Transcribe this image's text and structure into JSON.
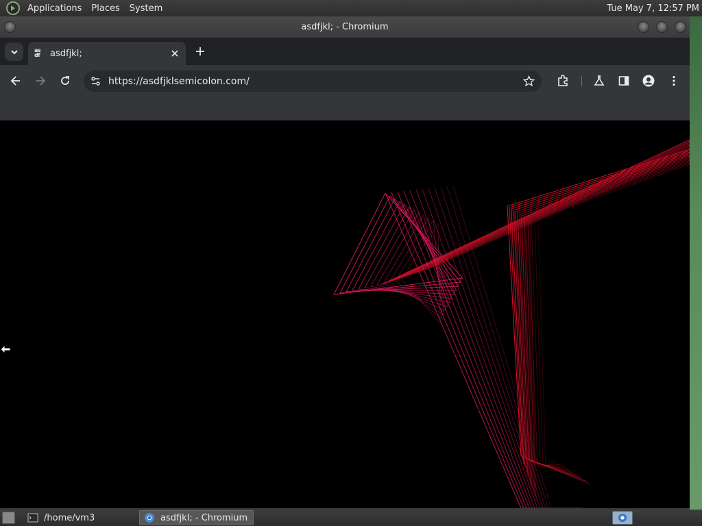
{
  "top_panel": {
    "menus": [
      "Applications",
      "Places",
      "System"
    ],
    "clock": "Tue May  7, 12:57 PM"
  },
  "window": {
    "title": "asdfjkl; - Chromium"
  },
  "browser": {
    "tab": {
      "favicon_text_top": "as",
      "favicon_text_bottom": "df",
      "title": "asdfjkl;"
    },
    "omnibox": {
      "url": "https://asdfjklsemicolon.com/"
    }
  },
  "taskbar": {
    "items": [
      {
        "label": "/home/vm3",
        "icon": "terminal-icon"
      },
      {
        "label": "asdfjkl; - Chromium",
        "icon": "chromium-icon"
      }
    ]
  },
  "colors": {
    "page_background": "#000000",
    "line_red": "#e0102a",
    "line_pink": "#d81a5a",
    "browser_frame": "#35363a"
  }
}
